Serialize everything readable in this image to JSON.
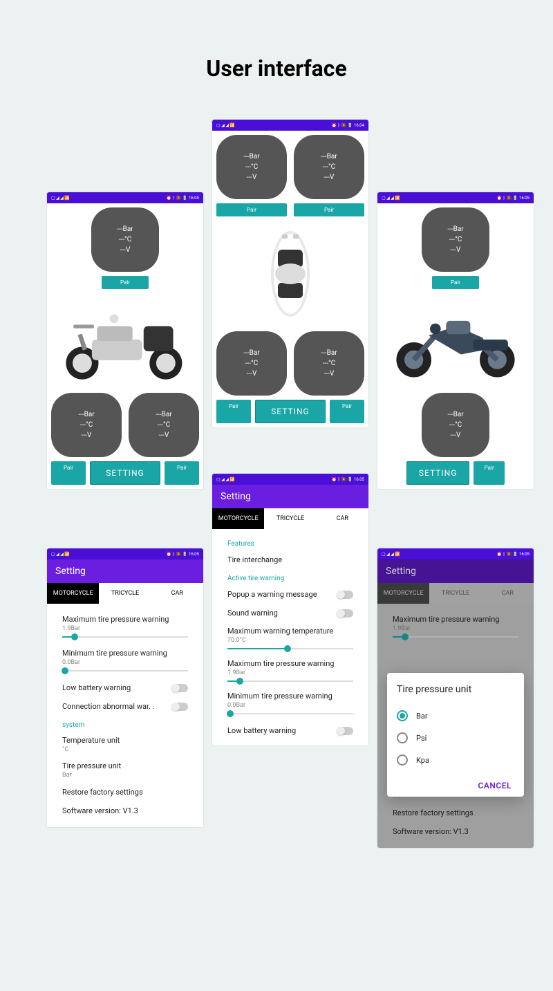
{
  "page_title": "User interface",
  "statusbar": {
    "time_1604": "16:04",
    "time_1605": "16:05",
    "icons_left": "▢ ◢ ◢ 📶",
    "icons_right": "⏰ ᛒ 🔕 🔋"
  },
  "setting_title": "Setting",
  "tabs": {
    "motorcycle": "MOTORCYCLE",
    "tricycle": "TRICYCLE",
    "car": "CAR"
  },
  "tire": {
    "bar": "---Bar",
    "c": "---°C",
    "v": "---V"
  },
  "buttons": {
    "pair": "Pair",
    "setting": "SETTING"
  },
  "s_left": {
    "max_pressure": {
      "label": "Maximum tire pressure warning",
      "value": "1.9Bar",
      "pct": 10
    },
    "min_pressure": {
      "label": "Minimum tire pressure warning",
      "value": "0.0Bar",
      "pct": 2
    },
    "low_battery": "Low battery warning",
    "conn_abnormal": "Connection abnormal war. .",
    "system_header": "system",
    "temp_unit": {
      "label": "Temperature unit",
      "value": "°C"
    },
    "press_unit": {
      "label": "Tire pressure unit",
      "value": "Bar"
    },
    "restore": "Restore factory settings",
    "version": "Software version: V1.3"
  },
  "s_center": {
    "features_header": "Features",
    "tire_interchange": "Tire interchange",
    "active_header": "Active tire warning",
    "popup": "Popup a warning message",
    "sound": "Sound warning",
    "max_temp": {
      "label": "Maximum warning temperature",
      "value": "70.0°C",
      "pct": 48
    },
    "max_pressure": {
      "label": "Maximum tire pressure warning",
      "value": "1.9Bar",
      "pct": 10
    },
    "min_pressure": {
      "label": "Minimum tire pressure warning",
      "value": "0.0Bar",
      "pct": 2
    },
    "low_battery": "Low battery warning"
  },
  "dialog": {
    "title": "Tire pressure unit",
    "options": {
      "bar": "Bar",
      "psi": "Psi",
      "kpa": "Kpa"
    },
    "cancel": "CANCEL"
  }
}
